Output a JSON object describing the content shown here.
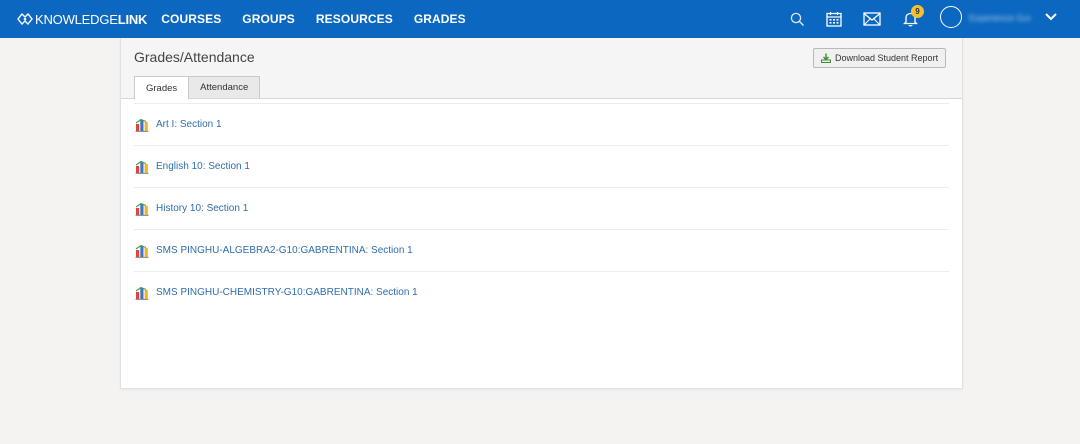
{
  "brand": {
    "part1": "KNOWLEDGE",
    "part2": "LINK"
  },
  "nav": [
    "COURSES",
    "GROUPS",
    "RESOURCES",
    "GRADES"
  ],
  "notifications_count": "9",
  "user": {
    "name": "Experience Gui"
  },
  "page": {
    "title": "Grades/Attendance",
    "download_button": "Download Student Report"
  },
  "tabs": [
    "Grades",
    "Attendance"
  ],
  "courses": [
    "Art I: Section 1",
    "English 10: Section 1",
    "History 10: Section 1",
    "SMS PINGHU-ALGEBRA2-G10:GABRENTINA: Section 1",
    "SMS PINGHU-CHEMISTRY-G10:GABRENTINA: Section 1"
  ],
  "icons": {
    "search": "search-icon",
    "calendar": "calendar-icon",
    "mail": "mail-icon",
    "bell": "bell-icon",
    "download": "download-icon",
    "grades_chart": "bar-chart-icon"
  },
  "colors": {
    "topbar": "#0b67bf",
    "link": "#2f6ea9",
    "badge": "#f2c12e"
  }
}
